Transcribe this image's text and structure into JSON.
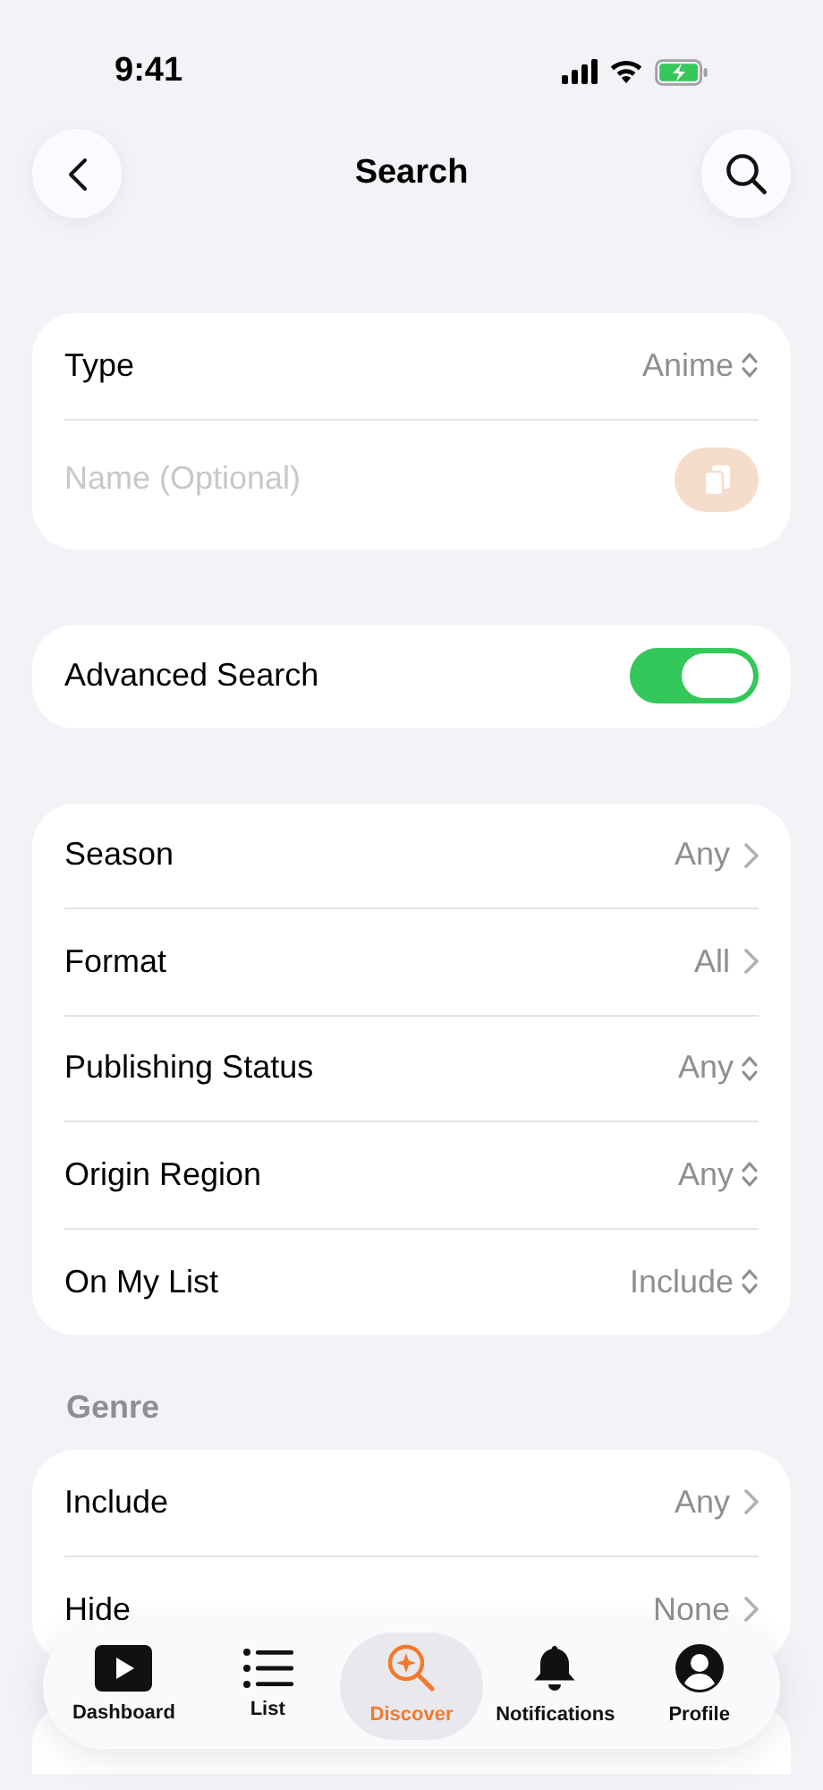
{
  "status_bar": {
    "time": "9:41"
  },
  "nav": {
    "title": "Search"
  },
  "search_card": {
    "type": {
      "label": "Type",
      "value": "Anime"
    },
    "name_field": {
      "placeholder": "Name (Optional)"
    }
  },
  "advanced_search": {
    "label": "Advanced Search",
    "on": true
  },
  "filters": [
    {
      "label": "Season",
      "value": "Any",
      "kind": "link"
    },
    {
      "label": "Format",
      "value": "All",
      "kind": "link"
    },
    {
      "label": "Publishing Status",
      "value": "Any",
      "kind": "menu"
    },
    {
      "label": "Origin Region",
      "value": "Any",
      "kind": "menu"
    },
    {
      "label": "On My List",
      "value": "Include",
      "kind": "menu"
    }
  ],
  "genre": {
    "header": "Genre",
    "rows": [
      {
        "label": "Include",
        "value": "Any",
        "kind": "link"
      },
      {
        "label": "Hide",
        "value": "None",
        "kind": "link"
      }
    ]
  },
  "tabs": [
    {
      "label": "Dashboard",
      "kind": "play",
      "selected": false
    },
    {
      "label": "List",
      "kind": "list",
      "selected": false
    },
    {
      "label": "Discover",
      "kind": "discover",
      "selected": true
    },
    {
      "label": "Notifications",
      "kind": "bell",
      "selected": false
    },
    {
      "label": "Profile",
      "kind": "person",
      "selected": false
    }
  ]
}
